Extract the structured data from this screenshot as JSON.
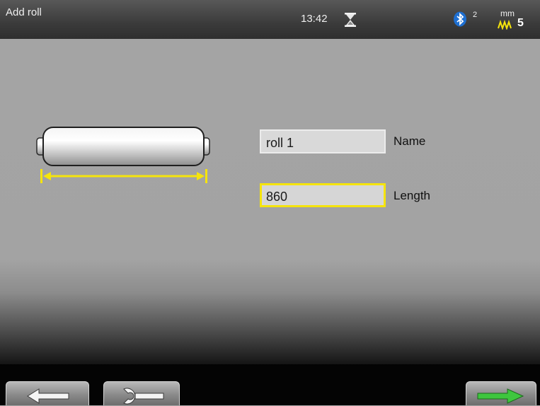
{
  "header": {
    "title": "Add roll",
    "time": "13:42",
    "hourglass_icon": "hourglass-icon",
    "bluetooth_icon": "bluetooth-icon",
    "bluetooth_count": "2",
    "unit": "mm",
    "filter_icon": "filter-wave-icon",
    "filter_value": "5"
  },
  "form": {
    "name_value": "roll 1",
    "name_label": "Name",
    "length_value": "860",
    "length_label": "Length"
  },
  "illustration": {
    "icon": "roll-length-icon",
    "accent_color": "#f5e40c"
  },
  "footer": {
    "back_icon": "arrow-left-icon",
    "settings_icon": "wrench-icon",
    "next_icon": "arrow-right-icon",
    "next_color": "#3ec63e"
  }
}
